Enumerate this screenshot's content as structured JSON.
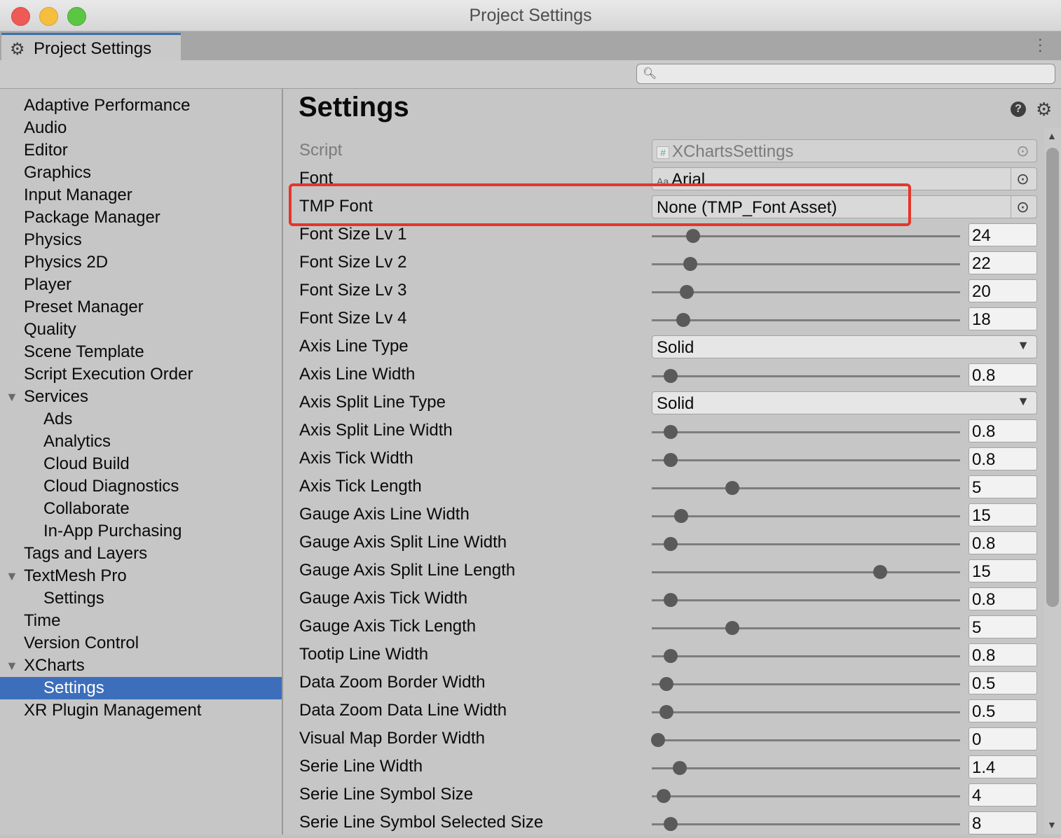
{
  "window": {
    "title": "Project Settings"
  },
  "tab": {
    "label": "Project Settings",
    "icon": "gear-icon"
  },
  "search": {
    "placeholder": "",
    "value": ""
  },
  "sidebar": {
    "items": [
      {
        "label": "Adaptive Performance",
        "indent": 0
      },
      {
        "label": "Audio",
        "indent": 0
      },
      {
        "label": "Editor",
        "indent": 0
      },
      {
        "label": "Graphics",
        "indent": 0
      },
      {
        "label": "Input Manager",
        "indent": 0
      },
      {
        "label": "Package Manager",
        "indent": 0
      },
      {
        "label": "Physics",
        "indent": 0
      },
      {
        "label": "Physics 2D",
        "indent": 0
      },
      {
        "label": "Player",
        "indent": 0
      },
      {
        "label": "Preset Manager",
        "indent": 0
      },
      {
        "label": "Quality",
        "indent": 0
      },
      {
        "label": "Scene Template",
        "indent": 0
      },
      {
        "label": "Script Execution Order",
        "indent": 0
      },
      {
        "label": "Services",
        "indent": 0,
        "expanded": true
      },
      {
        "label": "Ads",
        "indent": 1
      },
      {
        "label": "Analytics",
        "indent": 1
      },
      {
        "label": "Cloud Build",
        "indent": 1
      },
      {
        "label": "Cloud Diagnostics",
        "indent": 1
      },
      {
        "label": "Collaborate",
        "indent": 1
      },
      {
        "label": "In-App Purchasing",
        "indent": 1
      },
      {
        "label": "Tags and Layers",
        "indent": 0
      },
      {
        "label": "TextMesh Pro",
        "indent": 0,
        "expanded": true
      },
      {
        "label": "Settings",
        "indent": 1
      },
      {
        "label": "Time",
        "indent": 0
      },
      {
        "label": "Version Control",
        "indent": 0
      },
      {
        "label": "XCharts",
        "indent": 0,
        "expanded": true
      },
      {
        "label": "Settings",
        "indent": 1,
        "selected": true
      },
      {
        "label": "XR Plugin Management",
        "indent": 0
      }
    ]
  },
  "main": {
    "title": "Settings",
    "rows": [
      {
        "label": "Script",
        "type": "object",
        "value": "XChartsSettings",
        "prefix": "#",
        "disabled": true
      },
      {
        "label": "Font",
        "type": "object",
        "value": "Arial",
        "prefix": "Aa"
      },
      {
        "label": "TMP Font",
        "type": "object",
        "value": "None (TMP_Font Asset)",
        "highlighted": true
      },
      {
        "label": "Font Size Lv 1",
        "type": "slider",
        "value": "24",
        "fraction": 0.134
      },
      {
        "label": "Font Size Lv 2",
        "type": "slider",
        "value": "22",
        "fraction": 0.125
      },
      {
        "label": "Font Size Lv 3",
        "type": "slider",
        "value": "20",
        "fraction": 0.114
      },
      {
        "label": "Font Size Lv 4",
        "type": "slider",
        "value": "18",
        "fraction": 0.102
      },
      {
        "label": "Axis Line Type",
        "type": "dropdown",
        "value": "Solid"
      },
      {
        "label": "Axis Line Width",
        "type": "slider",
        "value": "0.8",
        "fraction": 0.061
      },
      {
        "label": "Axis Split Line Type",
        "type": "dropdown",
        "value": "Solid"
      },
      {
        "label": "Axis Split Line Width",
        "type": "slider",
        "value": "0.8",
        "fraction": 0.061
      },
      {
        "label": "Axis Tick Width",
        "type": "slider",
        "value": "0.8",
        "fraction": 0.061
      },
      {
        "label": "Axis Tick Length",
        "type": "slider",
        "value": "5",
        "fraction": 0.261
      },
      {
        "label": "Gauge Axis Line Width",
        "type": "slider",
        "value": "15",
        "fraction": 0.095
      },
      {
        "label": "Gauge Axis Split Line Width",
        "type": "slider",
        "value": "0.8",
        "fraction": 0.061
      },
      {
        "label": "Gauge Axis Split Line Length",
        "type": "slider",
        "value": "15",
        "fraction": 0.741
      },
      {
        "label": "Gauge Axis Tick Width",
        "type": "slider",
        "value": "0.8",
        "fraction": 0.061
      },
      {
        "label": "Gauge Axis Tick Length",
        "type": "slider",
        "value": "5",
        "fraction": 0.261
      },
      {
        "label": "Tootip Line Width",
        "type": "slider",
        "value": "0.8",
        "fraction": 0.061
      },
      {
        "label": "Data Zoom Border Width",
        "type": "slider",
        "value": "0.5",
        "fraction": 0.048
      },
      {
        "label": "Data Zoom Data Line Width",
        "type": "slider",
        "value": "0.5",
        "fraction": 0.048
      },
      {
        "label": "Visual Map Border Width",
        "type": "slider",
        "value": "0",
        "fraction": 0.02
      },
      {
        "label": "Serie Line Width",
        "type": "slider",
        "value": "1.4",
        "fraction": 0.091
      },
      {
        "label": "Serie Line Symbol Size",
        "type": "slider",
        "value": "4",
        "fraction": 0.039
      },
      {
        "label": "Serie Line Symbol Selected Size",
        "type": "slider",
        "value": "8",
        "fraction": 0.061
      }
    ]
  },
  "colors": {
    "highlight": "#e4352b",
    "selection": "#3d6ebb"
  }
}
